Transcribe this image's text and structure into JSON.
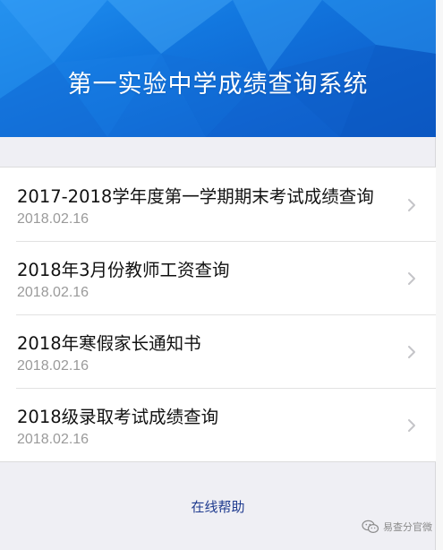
{
  "banner": {
    "title": "第一实验中学成绩查询系统",
    "colors": {
      "top": "#1f8ff0",
      "bottom": "#0b57c4"
    }
  },
  "list": {
    "items": [
      {
        "title": "2017-2018学年度第一学期期末考试成绩查询",
        "date": "2018.02.16"
      },
      {
        "title": "2018年3月份教师工资查询",
        "date": "2018.02.16"
      },
      {
        "title": "2018年寒假家长通知书",
        "date": "2018.02.16"
      },
      {
        "title": "2018级录取考试成绩查询",
        "date": "2018.02.16"
      }
    ]
  },
  "footer": {
    "help_label": "在线帮助",
    "help_color": "#1f3b8f"
  },
  "watermark": {
    "text": "易查分官微",
    "icon": "wechat-icon"
  }
}
